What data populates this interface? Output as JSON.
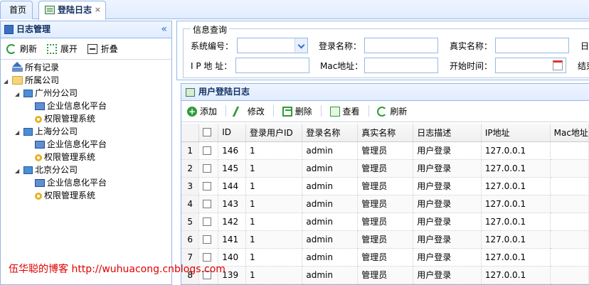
{
  "tabs": {
    "home": "首页",
    "active": "登陆日志",
    "close": "×"
  },
  "sidebar": {
    "title": "日志管理",
    "collapse": "«",
    "tools": {
      "refresh": "刷新",
      "expand": "展开",
      "fold": "折叠"
    },
    "tree": {
      "all": "所有记录",
      "company": "所属公司",
      "branches": [
        {
          "name": "广州分公司",
          "children": [
            "企业信息化平台",
            "权限管理系统"
          ]
        },
        {
          "name": "上海分公司",
          "children": [
            "企业信息化平台",
            "权限管理系统"
          ]
        },
        {
          "name": "北京分公司",
          "children": [
            "企业信息化平台",
            "权限管理系统"
          ]
        }
      ]
    }
  },
  "search": {
    "legend": "信息查询",
    "system_no": "系统编号：",
    "login_name": "登录名称：",
    "real_name": "真实名称：",
    "date_partial": "日",
    "ip": "I P 地 址：",
    "mac": "Mac地址：",
    "start_time": "开始时间：",
    "end_partial": "结束"
  },
  "grid": {
    "title": "用户登陆日志",
    "tools": {
      "add": "添加",
      "edit": "修改",
      "delete": "删除",
      "view": "查看",
      "refresh": "刷新"
    },
    "columns": [
      "ID",
      "登录用户ID",
      "登录名称",
      "真实名称",
      "日志描述",
      "IP地址",
      "Mac地址"
    ],
    "rows": [
      {
        "n": "1",
        "id": "146",
        "uid": "1",
        "login": "admin",
        "real": "管理员",
        "desc": "用户登录",
        "ip": "127.0.0.1"
      },
      {
        "n": "2",
        "id": "145",
        "uid": "1",
        "login": "admin",
        "real": "管理员",
        "desc": "用户登录",
        "ip": "127.0.0.1"
      },
      {
        "n": "3",
        "id": "144",
        "uid": "1",
        "login": "admin",
        "real": "管理员",
        "desc": "用户登录",
        "ip": "127.0.0.1"
      },
      {
        "n": "4",
        "id": "143",
        "uid": "1",
        "login": "admin",
        "real": "管理员",
        "desc": "用户登录",
        "ip": "127.0.0.1"
      },
      {
        "n": "5",
        "id": "142",
        "uid": "1",
        "login": "admin",
        "real": "管理员",
        "desc": "用户登录",
        "ip": "127.0.0.1"
      },
      {
        "n": "6",
        "id": "141",
        "uid": "1",
        "login": "admin",
        "real": "管理员",
        "desc": "用户登录",
        "ip": "127.0.0.1"
      },
      {
        "n": "7",
        "id": "140",
        "uid": "1",
        "login": "admin",
        "real": "管理员",
        "desc": "用户登录",
        "ip": "127.0.0.1"
      },
      {
        "n": "8",
        "id": "139",
        "uid": "1",
        "login": "admin",
        "real": "管理员",
        "desc": "用户登录",
        "ip": "127.0.0.1"
      }
    ]
  },
  "watermark": "伍华聪的博客 http://wuhuacong.cnblogs.com"
}
